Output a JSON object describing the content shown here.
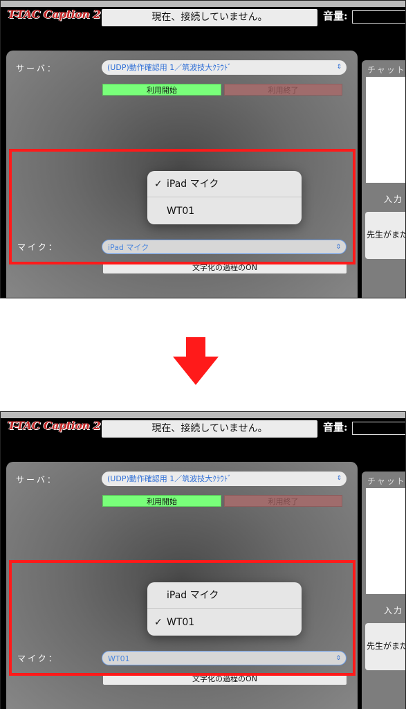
{
  "app": {
    "title": "T-TAC Caption 2",
    "status": "現在、接続していません。",
    "volume_label": "音量:"
  },
  "server": {
    "label": "サーバ：",
    "selected": "(UDP)動作確認用 1／筑波技大ｸﾗｳﾄﾞ"
  },
  "buttons": {
    "start": "利用開始",
    "end": "利用終了",
    "text_process_on": "文字化の過程のON"
  },
  "right_panel": {
    "chat_label": "チャット",
    "input_label": "入力",
    "teacher_text": "先生がまだ"
  },
  "mic": {
    "label": "マイク：",
    "options": [
      "iPad マイク",
      "WT01"
    ]
  },
  "before": {
    "mic_selected": "iPad マイク",
    "checked_index": 0
  },
  "after": {
    "mic_selected": "WT01",
    "checked_index": 1
  },
  "icons": {
    "check": "✓",
    "chevron": "up-down-chevron-icon",
    "arrow": "down-arrow-icon"
  },
  "colors": {
    "highlight": "#ff1a1a",
    "start_button": "#79ff7a",
    "end_button": "#a06c6c",
    "title": "#c62828",
    "select_text": "#2f6fd6"
  }
}
